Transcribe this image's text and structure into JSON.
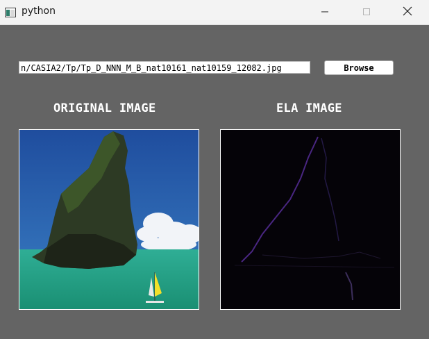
{
  "window": {
    "title": "python",
    "icon": "python-tk-window-icon"
  },
  "controls": {
    "minimize_icon": "minimize-icon",
    "maximize_icon": "maximize-icon",
    "close_icon": "close-icon"
  },
  "file_path": {
    "value": "n/CASIA2/Tp/Tp_D_NNN_M_B_nat10161_nat10159_12082.jpg"
  },
  "browse_button": {
    "label": "Browse"
  },
  "panels": {
    "original_label": "ORIGINAL IMAGE",
    "ela_label": "ELA IMAGE"
  },
  "colors": {
    "window_bg": "#646464",
    "titlebar_bg": "#f3f3f3",
    "heading_text": "#ffffff"
  }
}
